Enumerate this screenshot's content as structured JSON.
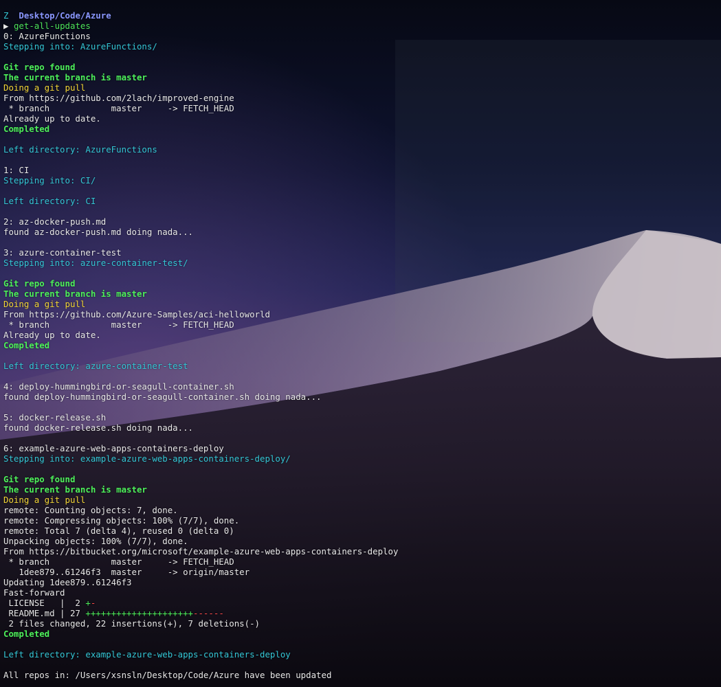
{
  "prompt": {
    "marker": "Z",
    "path": "Desktop/Code/Azure",
    "arrow": "▶",
    "command": "get-all-updates"
  },
  "lines": [
    {
      "t": "0: AzureFunctions",
      "c": "white"
    },
    {
      "t": "Stepping into: AzureFunctions/",
      "c": "cyan"
    },
    {
      "t": "",
      "c": "blank"
    },
    {
      "t": "Git repo found",
      "c": "green"
    },
    {
      "t": "The current branch is master",
      "c": "green"
    },
    {
      "t": "Doing a git pull",
      "c": "yellow"
    },
    {
      "t": "From https://github.com/2lach/improved-engine",
      "c": "white"
    },
    {
      "t": " * branch            master     -> FETCH_HEAD",
      "c": "white"
    },
    {
      "t": "Already up to date.",
      "c": "white"
    },
    {
      "t": "Completed",
      "c": "green"
    },
    {
      "t": "",
      "c": "blank"
    },
    {
      "t": "Left directory: AzureFunctions",
      "c": "cyan"
    },
    {
      "t": "",
      "c": "blank"
    },
    {
      "t": "1: CI",
      "c": "white"
    },
    {
      "t": "Stepping into: CI/",
      "c": "cyan"
    },
    {
      "t": "",
      "c": "blank"
    },
    {
      "t": "Left directory: CI",
      "c": "cyan"
    },
    {
      "t": "",
      "c": "blank"
    },
    {
      "t": "2: az-docker-push.md",
      "c": "white"
    },
    {
      "t": "found az-docker-push.md doing nada...",
      "c": "white"
    },
    {
      "t": "",
      "c": "blank"
    },
    {
      "t": "3: azure-container-test",
      "c": "white"
    },
    {
      "t": "Stepping into: azure-container-test/",
      "c": "cyan"
    },
    {
      "t": "",
      "c": "blank"
    },
    {
      "t": "Git repo found",
      "c": "green"
    },
    {
      "t": "The current branch is master",
      "c": "green"
    },
    {
      "t": "Doing a git pull",
      "c": "yellow"
    },
    {
      "t": "From https://github.com/Azure-Samples/aci-helloworld",
      "c": "white"
    },
    {
      "t": " * branch            master     -> FETCH_HEAD",
      "c": "white"
    },
    {
      "t": "Already up to date.",
      "c": "white"
    },
    {
      "t": "Completed",
      "c": "green"
    },
    {
      "t": "",
      "c": "blank"
    },
    {
      "t": "Left directory: azure-container-test",
      "c": "cyan"
    },
    {
      "t": "",
      "c": "blank"
    },
    {
      "t": "4: deploy-hummingbird-or-seagull-container.sh",
      "c": "white"
    },
    {
      "t": "found deploy-hummingbird-or-seagull-container.sh doing nada...",
      "c": "white"
    },
    {
      "t": "",
      "c": "blank"
    },
    {
      "t": "5: docker-release.sh",
      "c": "white"
    },
    {
      "t": "found docker-release.sh doing nada...",
      "c": "white"
    },
    {
      "t": "",
      "c": "blank"
    },
    {
      "t": "6: example-azure-web-apps-containers-deploy",
      "c": "white"
    },
    {
      "t": "Stepping into: example-azure-web-apps-containers-deploy/",
      "c": "cyan"
    },
    {
      "t": "",
      "c": "blank"
    },
    {
      "t": "Git repo found",
      "c": "green"
    },
    {
      "t": "The current branch is master",
      "c": "green"
    },
    {
      "t": "Doing a git pull",
      "c": "yellow"
    },
    {
      "t": "remote: Counting objects: 7, done.",
      "c": "white"
    },
    {
      "t": "remote: Compressing objects: 100% (7/7), done.",
      "c": "white"
    },
    {
      "t": "remote: Total 7 (delta 4), reused 0 (delta 0)",
      "c": "white"
    },
    {
      "t": "Unpacking objects: 100% (7/7), done.",
      "c": "white"
    },
    {
      "t": "From https://bitbucket.org/microsoft/example-azure-web-apps-containers-deploy",
      "c": "white"
    },
    {
      "t": " * branch            master     -> FETCH_HEAD",
      "c": "white"
    },
    {
      "t": "   1dee879..61246f3  master     -> origin/master",
      "c": "white"
    },
    {
      "t": "Updating 1dee879..61246f3",
      "c": "white"
    },
    {
      "t": "Fast-forward",
      "c": "white"
    }
  ],
  "diffstat": [
    {
      "file": " LICENSE   |  2 ",
      "add": "+",
      "del": "-"
    },
    {
      "file": " README.md | 27 ",
      "add": "+++++++++++++++++++++",
      "del": "------"
    }
  ],
  "after_lines": [
    {
      "t": " 2 files changed, 22 insertions(+), 7 deletions(-)",
      "c": "white"
    },
    {
      "t": "Completed",
      "c": "green"
    },
    {
      "t": "",
      "c": "blank"
    },
    {
      "t": "Left directory: example-azure-web-apps-containers-deploy",
      "c": "cyan"
    },
    {
      "t": "",
      "c": "blank"
    },
    {
      "t": "All repos in: /Users/xsnsln/Desktop/Code/Azure have been updated",
      "c": "white"
    }
  ],
  "colors": {
    "cyan": "#34c7d6",
    "green": "#4df05a",
    "yellow": "#f3d636",
    "white": "#e8e8e8",
    "path_blue": "#8a97ff",
    "deletion_red": "#ff4a4a"
  }
}
